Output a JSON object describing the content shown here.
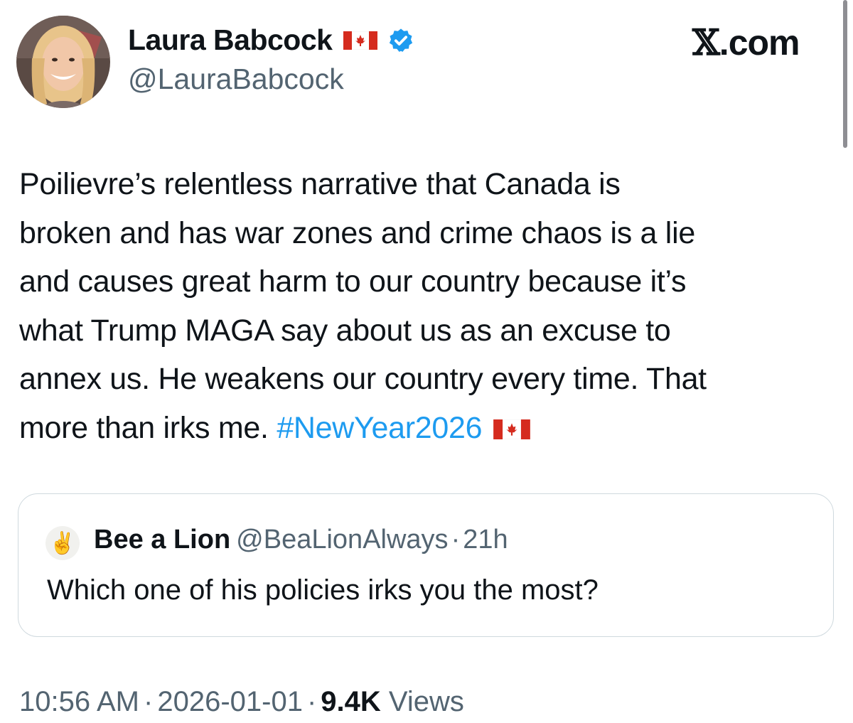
{
  "author": {
    "display_name": "Laura Babcock",
    "handle": "@LauraBabcock",
    "flag_icon": "canada-flag-icon",
    "verified_icon": "verified-badge-icon"
  },
  "brand": {
    "label": ".com",
    "mark": "𝕏"
  },
  "tweet": {
    "lines": [
      "Poilievre’s relentless narrative that Canada is",
      "broken and has war zones and crime chaos is a lie",
      "and causes great harm to our country because it’s",
      "what Trump MAGA say about us as an excuse to",
      "annex us. He weakens our country every time. That"
    ],
    "last_line_text": "more than irks me. ",
    "hashtag": "#NewYear2026"
  },
  "quoted_tweet": {
    "avatar_emoji": "✌️",
    "display_name": "Bee a Lion",
    "handle": "@BeaLionAlways",
    "separator": "·",
    "time": "21h",
    "text": "Which one of his policies irks you the most?"
  },
  "meta": {
    "time": "10:56 AM",
    "separator": "·",
    "date": "2026-01-01",
    "views_count": "9.4K",
    "views_label": "Views"
  },
  "colors": {
    "text": "#0f1419",
    "secondary": "#536471",
    "link": "#1d9bf0",
    "verified": "#1d9bf0",
    "flag_red": "#d52b1e",
    "border": "#cfd9de"
  }
}
